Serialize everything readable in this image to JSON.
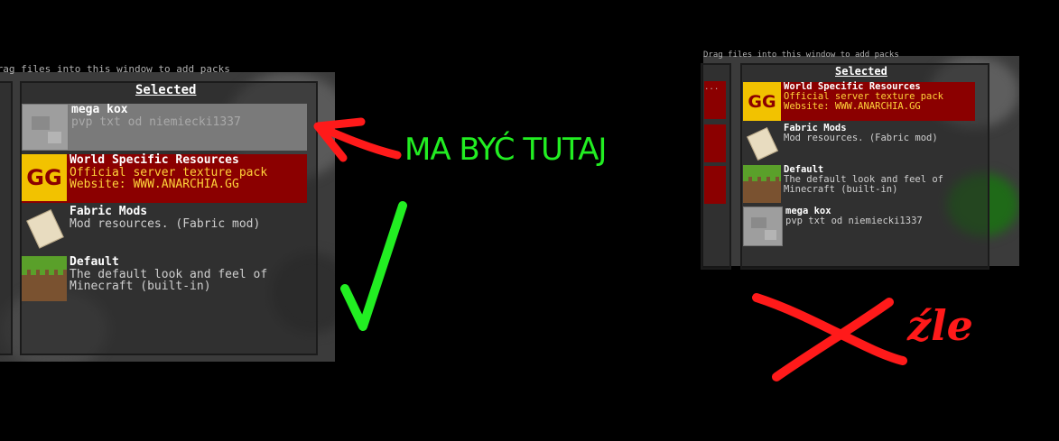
{
  "header_fragment": "Drag files into this window to add packs",
  "left_panel": {
    "selected_title": "Selected",
    "entries": [
      {
        "name": "mega kox",
        "line1": "pvp txt od niemiecki1337",
        "line2": "",
        "icon": "stone-icon",
        "style": "gray"
      },
      {
        "name": "World Specific Resources",
        "line1": "Official server texture pack",
        "line2": "Website: WWW.ANARCHIA.GG",
        "icon": "gg-logo-icon",
        "style": "red",
        "icon_text": "GG"
      },
      {
        "name": "Fabric Mods",
        "line1": "Mod resources. (Fabric mod)",
        "line2": "",
        "icon": "scroll-icon",
        "style": "plain"
      },
      {
        "name": "Default",
        "line1": "The default look and feel of",
        "line2": "Minecraft (built-in)",
        "icon": "grass-block-icon",
        "style": "plain"
      }
    ]
  },
  "right_panel": {
    "selected_title": "Selected",
    "left_column_fragment": "...",
    "entries": [
      {
        "name": "World Specific Resources",
        "line1": "Official server texture pack",
        "line2": "Website: WWW.ANARCHIA.GG",
        "icon": "gg-logo-icon",
        "style": "red",
        "icon_text": "GG"
      },
      {
        "name": "Fabric Mods",
        "line1": "Mod resources. (Fabric mod)",
        "line2": "",
        "icon": "scroll-icon",
        "style": "plain"
      },
      {
        "name": "Default",
        "line1": "The default look and feel of",
        "line2": "Minecraft (built-in)",
        "icon": "grass-block-icon",
        "style": "plain"
      },
      {
        "name": "mega kox",
        "line1": "pvp txt od niemiecki1337",
        "line2": "",
        "icon": "stone-icon",
        "style": "plain"
      }
    ]
  },
  "annotations": {
    "correct_label": "MA BYĆ TUTAJ",
    "wrong_label": "źle",
    "arrow_color": "#ff1a1a",
    "check_color": "#22ee22",
    "cross_color": "#ff1a1a"
  }
}
